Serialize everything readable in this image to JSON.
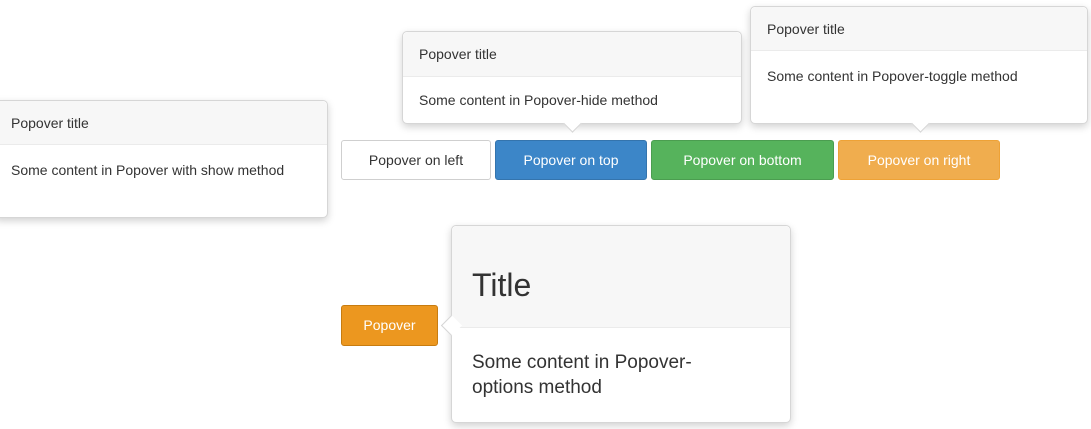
{
  "popovers": {
    "left": {
      "title": "Popover title",
      "content": "Some content in Popover with show method"
    },
    "top": {
      "title": "Popover title",
      "content": "Some content in Popover-hide method"
    },
    "right": {
      "title": "Popover title",
      "content": "Some content in Popover-toggle method"
    },
    "options": {
      "title": "Title",
      "content": "Some content in Popover-options method"
    }
  },
  "buttons": {
    "left": "Popover on left",
    "top": "Popover on top",
    "bottom": "Popover on bottom",
    "right": "Popover on right",
    "options": "Popover"
  },
  "colors": {
    "default_bg": "#ffffff",
    "primary": "#3c86c8",
    "success": "#56b35c",
    "warning": "#f0ad4e",
    "warning_dark": "#ec971f"
  }
}
